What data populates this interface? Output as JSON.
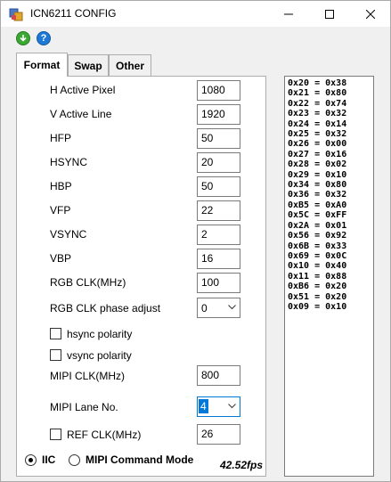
{
  "window": {
    "title": "ICN6211 CONFIG"
  },
  "tabs": [
    {
      "label": "Format",
      "active": true
    },
    {
      "label": "Swap",
      "active": false
    },
    {
      "label": "Other",
      "active": false
    }
  ],
  "format": {
    "fields": [
      {
        "label": "H Active Pixel",
        "value": "1080"
      },
      {
        "label": "V Active Line",
        "value": "1920"
      },
      {
        "label": "HFP",
        "value": "50"
      },
      {
        "label": "HSYNC",
        "value": "20"
      },
      {
        "label": "HBP",
        "value": "50"
      },
      {
        "label": "VFP",
        "value": "22"
      },
      {
        "label": "VSYNC",
        "value": "2"
      },
      {
        "label": "VBP",
        "value": "16"
      },
      {
        "label": "RGB CLK(MHz)",
        "value": "100"
      }
    ],
    "rgb_phase": {
      "label": "RGB CLK phase adjust",
      "value": "0"
    },
    "hsync_polarity": {
      "label": "hsync polarity",
      "checked": false
    },
    "vsync_polarity": {
      "label": "vsync polarity",
      "checked": false
    },
    "mipi_clk": {
      "label": "MIPI CLK(MHz)",
      "value": "800"
    },
    "mipi_lane": {
      "label": "MIPI Lane No.",
      "value": "4"
    },
    "ref_clk": {
      "label": "REF CLK(MHz)",
      "value": "26",
      "checked": false
    },
    "mode": {
      "iic_label": "IIC",
      "mipi_label": "MIPI Command Mode",
      "selected": "IIC"
    },
    "fps": "42.52fps"
  },
  "registers": [
    "0x20 = 0x38",
    "0x21 = 0x80",
    "0x22 = 0x74",
    "0x23 = 0x32",
    "0x24 = 0x14",
    "0x25 = 0x32",
    "0x26 = 0x00",
    "0x27 = 0x16",
    "0x28 = 0x02",
    "0x29 = 0x10",
    "0x34 = 0x80",
    "0x36 = 0x32",
    "0xB5 = 0xA0",
    "0x5C = 0xFF",
    "0x2A = 0x01",
    "0x56 = 0x92",
    "0x6B = 0x33",
    "0x69 = 0x0C",
    "0x10 = 0x40",
    "0x11 = 0x88",
    "0xB6 = 0x20",
    "0x51 = 0x20",
    "0x09 = 0x10"
  ]
}
